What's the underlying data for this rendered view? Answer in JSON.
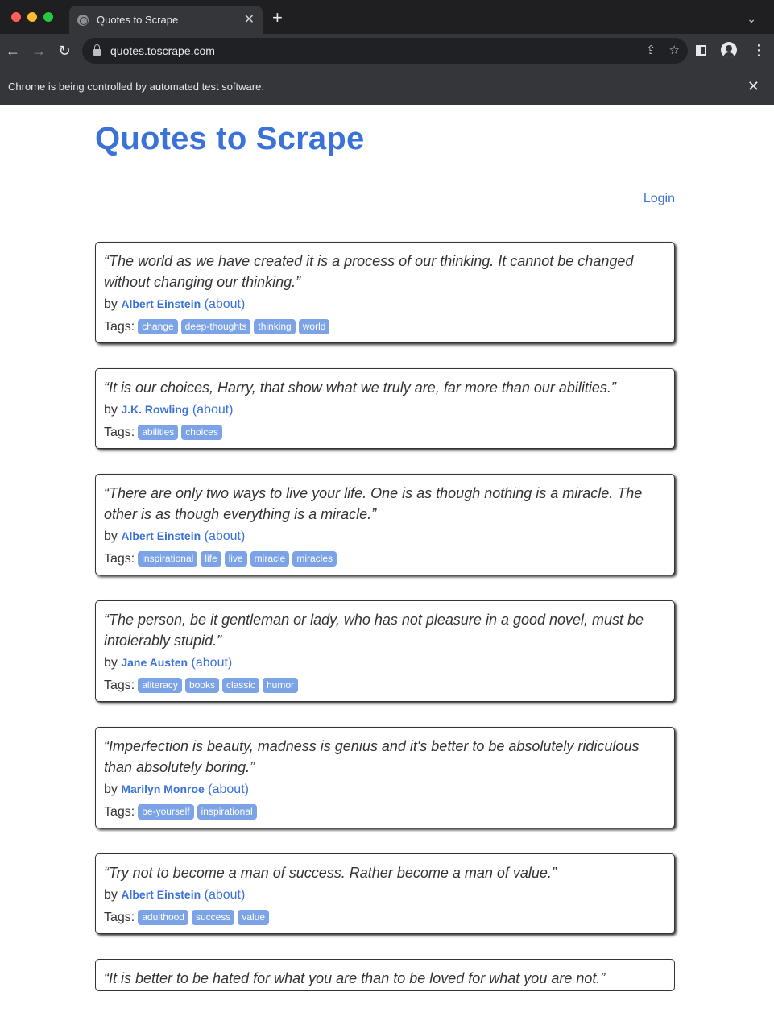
{
  "browser": {
    "tab_title": "Quotes to Scrape",
    "url": "quotes.toscrape.com",
    "infobar_message": "Chrome is being controlled by automated test software."
  },
  "site": {
    "title": "Quotes to Scrape",
    "login_label": "Login"
  },
  "labels": {
    "by": "by",
    "about": "(about)",
    "tags": "Tags:"
  },
  "quotes": [
    {
      "text": "“The world as we have created it is a process of our thinking. It cannot be changed without changing our thinking.”",
      "author": "Albert Einstein",
      "tags": [
        "change",
        "deep-thoughts",
        "thinking",
        "world"
      ]
    },
    {
      "text": "“It is our choices, Harry, that show what we truly are, far more than our abilities.”",
      "author": "J.K. Rowling",
      "tags": [
        "abilities",
        "choices"
      ]
    },
    {
      "text": "“There are only two ways to live your life. One is as though nothing is a miracle. The other is as though everything is a miracle.”",
      "author": "Albert Einstein",
      "tags": [
        "inspirational",
        "life",
        "live",
        "miracle",
        "miracles"
      ]
    },
    {
      "text": "“The person, be it gentleman or lady, who has not pleasure in a good novel, must be intolerably stupid.”",
      "author": "Jane Austen",
      "tags": [
        "aliteracy",
        "books",
        "classic",
        "humor"
      ]
    },
    {
      "text": "“Imperfection is beauty, madness is genius and it's better to be absolutely ridiculous than absolutely boring.”",
      "author": "Marilyn Monroe",
      "tags": [
        "be-yourself",
        "inspirational"
      ]
    },
    {
      "text": "“Try not to become a man of success. Rather become a man of value.”",
      "author": "Albert Einstein",
      "tags": [
        "adulthood",
        "success",
        "value"
      ]
    },
    {
      "text": "“It is better to be hated for what you are than to be loved for what you are not.”",
      "author": "",
      "tags": []
    }
  ]
}
